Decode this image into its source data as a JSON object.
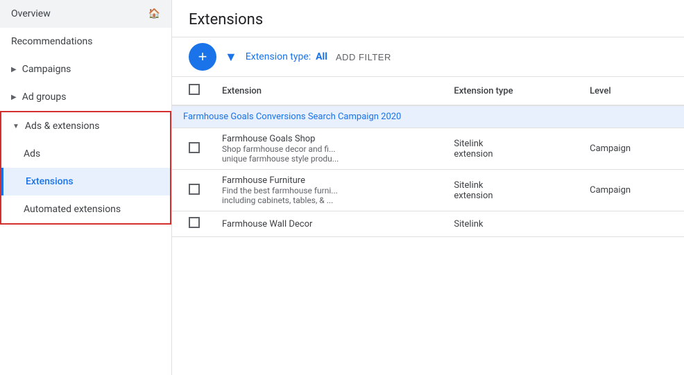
{
  "sidebar": {
    "overview_label": "Overview",
    "recommendations_label": "Recommendations",
    "campaigns_label": "Campaigns",
    "adgroups_label": "Ad groups",
    "ads_extensions_label": "Ads & extensions",
    "ads_label": "Ads",
    "extensions_label": "Extensions",
    "automated_extensions_label": "Automated extensions"
  },
  "header": {
    "title": "Extensions"
  },
  "toolbar": {
    "filter_label": "Extension type:",
    "filter_value": "All",
    "add_filter_label": "ADD FILTER"
  },
  "table": {
    "col_extension": "Extension",
    "col_extension_type": "Extension type",
    "col_level": "Level",
    "campaign_row_label": "Farmhouse Goals Conversions Search Campaign 2020",
    "rows": [
      {
        "name": "Farmhouse Goals Shop",
        "desc1": "Shop farmhouse decor and fi...",
        "desc2": "unique farmhouse style produ...",
        "type": "Sitelink extension",
        "level": "Campaign"
      },
      {
        "name": "Farmhouse Furniture",
        "desc1": "Find the best farmhouse furni...",
        "desc2": "including cabinets, tables, & ...",
        "type": "Sitelink extension",
        "level": "Campaign"
      },
      {
        "name": "Farmhouse Wall Decor",
        "desc1": "",
        "desc2": "",
        "type": "Sitelink",
        "level": ""
      }
    ]
  }
}
